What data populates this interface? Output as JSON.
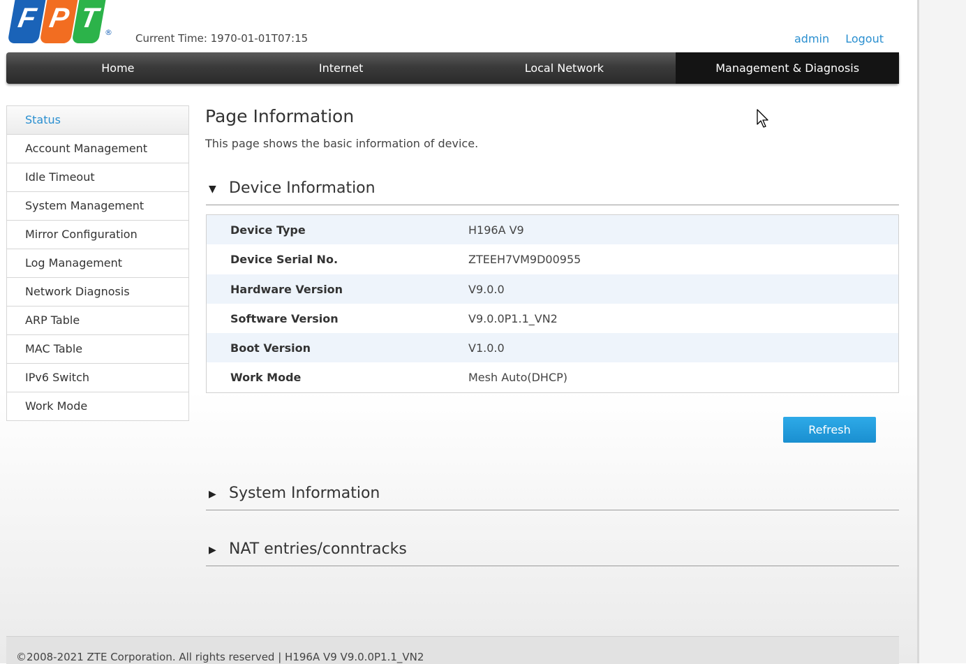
{
  "brand": {
    "logo_letters": [
      "F",
      "P",
      "T"
    ],
    "registered": "®"
  },
  "header": {
    "current_time": "Current Time: 1970-01-01T07:15",
    "user": "admin",
    "logout": "Logout"
  },
  "nav": {
    "items": [
      "Home",
      "Internet",
      "Local Network",
      "Management & Diagnosis"
    ],
    "active_index": 3
  },
  "sidebar": {
    "items": [
      "Status",
      "Account Management",
      "Idle Timeout",
      "System Management",
      "Mirror Configuration",
      "Log Management",
      "Network Diagnosis",
      "ARP Table",
      "MAC Table",
      "IPv6 Switch",
      "Work Mode"
    ],
    "active_index": 0
  },
  "page": {
    "title": "Page Information",
    "description": "This page shows the basic information of device."
  },
  "device_info": {
    "title": "Device Information",
    "expanded": true,
    "rows": [
      {
        "label": "Device Type",
        "value": "H196A V9"
      },
      {
        "label": "Device Serial No.",
        "value": "ZTEEH7VM9D00955"
      },
      {
        "label": "Hardware Version",
        "value": "V9.0.0"
      },
      {
        "label": "Software Version",
        "value": "V9.0.0P1.1_VN2"
      },
      {
        "label": "Boot Version",
        "value": "V1.0.0"
      },
      {
        "label": "Work Mode",
        "value": "Mesh Auto(DHCP)"
      }
    ]
  },
  "refresh_label": "Refresh",
  "system_info": {
    "title": "System Information",
    "expanded": false
  },
  "nat_info": {
    "title": "NAT entries/conntracks",
    "expanded": false
  },
  "footer": {
    "text": "©2008-2021 ZTE Corporation. All rights reserved  |   H196A V9 V9.0.0P1.1_VN2"
  },
  "colors": {
    "accent": "#2a8fd0",
    "nav_dark": "#2a2a2a",
    "button": "#1a8fd0"
  }
}
